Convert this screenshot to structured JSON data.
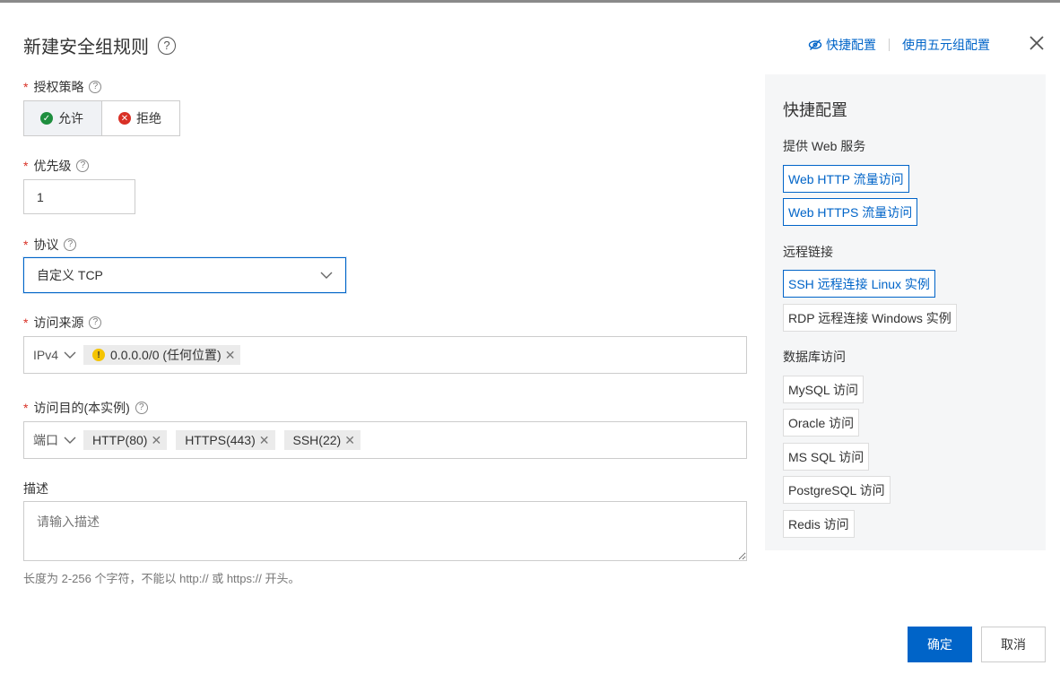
{
  "dialog": {
    "title": "新建安全组规则",
    "header_links": [
      "快捷配置",
      "使用五元组配置"
    ]
  },
  "form": {
    "policy": {
      "label": "授权策略",
      "options": [
        "允许",
        "拒绝"
      ],
      "selected": "允许"
    },
    "priority": {
      "label": "优先级",
      "value": "1"
    },
    "protocol": {
      "label": "协议",
      "value": "自定义 TCP"
    },
    "source": {
      "label": "访问来源",
      "type": "IPv4",
      "tags": [
        "0.0.0.0/0 (任何位置)"
      ]
    },
    "destination": {
      "label": "访问目的(本实例)",
      "type": "端口",
      "tags": [
        "HTTP(80)",
        "HTTPS(443)",
        "SSH(22)"
      ]
    },
    "description": {
      "label": "描述",
      "placeholder": "请输入描述",
      "hint": "长度为 2-256 个字符，不能以 http:// 或 https:// 开头。"
    }
  },
  "panel": {
    "title": "快捷配置",
    "groups": [
      {
        "title": "提供 Web 服务",
        "items": [
          "Web HTTP 流量访问",
          "Web HTTPS 流量访问"
        ]
      },
      {
        "title": "远程链接",
        "items": [
          "SSH 远程连接 Linux 实例",
          "RDP 远程连接 Windows 实例"
        ]
      },
      {
        "title": "数据库访问",
        "items": [
          "MySQL 访问",
          "Oracle 访问",
          "MS SQL 访问",
          "PostgreSQL 访问",
          "Redis 访问"
        ]
      }
    ]
  },
  "footer": {
    "confirm": "确定",
    "cancel": "取消"
  },
  "colors": {
    "primary": "#0064c8",
    "required": "#d93026",
    "allow": "#1e8e3e",
    "warn": "#f5c400"
  }
}
